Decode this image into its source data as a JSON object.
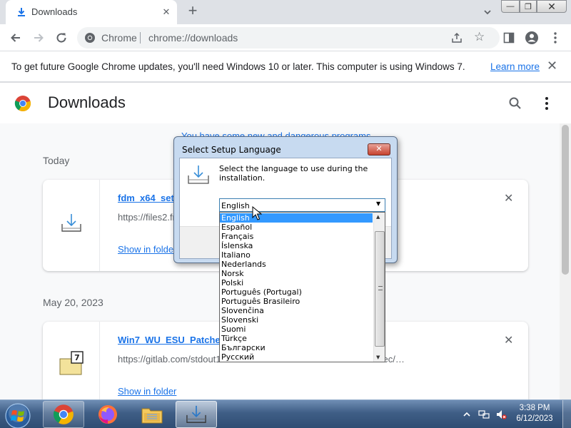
{
  "browser": {
    "tab": {
      "title": "Downloads",
      "close_glyph": "✕",
      "icon": "download-icon"
    },
    "new_tab_glyph": "+",
    "omnibox": {
      "site_label": "Chrome",
      "url": "chrome://downloads"
    },
    "window_buttons": {
      "minimize": "—",
      "maximize": "❐",
      "close": "✕"
    }
  },
  "infobar": {
    "message": "To get future Google Chrome updates, you'll need Windows 10 or later. This computer is using Windows 7.",
    "link": "Learn more",
    "close_glyph": "✕"
  },
  "page": {
    "title": "Downloads",
    "banner_partial": "You have some new and dangerous programs…",
    "groups": [
      {
        "date": "Today",
        "item": {
          "name": "fdm_x64_setup.exe",
          "url": "https://files2.freedownloadmanager.org/6/latest/fdm_x64_setup.exe",
          "action": "Show in folder",
          "close_glyph": "✕"
        }
      },
      {
        "date": "May 20, 2023",
        "item": {
          "name": "Win7_WU_ESU_Patcher.7z",
          "url": "https://gitlab.com/stdout12/adventures/-/raw/4ee142986b48e593ec/…",
          "action": "Show in folder",
          "close_glyph": "✕"
        }
      }
    ]
  },
  "dialog": {
    "title": "Select Setup Language",
    "close_glyph": "✕",
    "prompt": "Select the language to use during the installation.",
    "combo_value": "English",
    "combo_arrow": "▼",
    "languages": [
      "English",
      "Español",
      "Français",
      "Íslenska",
      "Italiano",
      "Nederlands",
      "Norsk",
      "Polski",
      "Português (Portugal)",
      "Português Brasileiro",
      "Slovenčina",
      "Slovenski",
      "Suomi",
      "Türkçe",
      "Български",
      "Русский"
    ],
    "selected_language": "English",
    "scroll_up": "▲",
    "scroll_down": "▼"
  },
  "taskbar": {
    "apps": [
      "chrome-icon",
      "firefox-icon",
      "file-explorer-icon",
      "setup-installer-icon"
    ],
    "time": "3:38 PM",
    "date": "6/12/2023"
  },
  "colors": {
    "accent": "#1a73e8",
    "list_selection": "#3399ff",
    "taskbar": "#3f5e86",
    "dialog_frame": "#c7daf0"
  }
}
